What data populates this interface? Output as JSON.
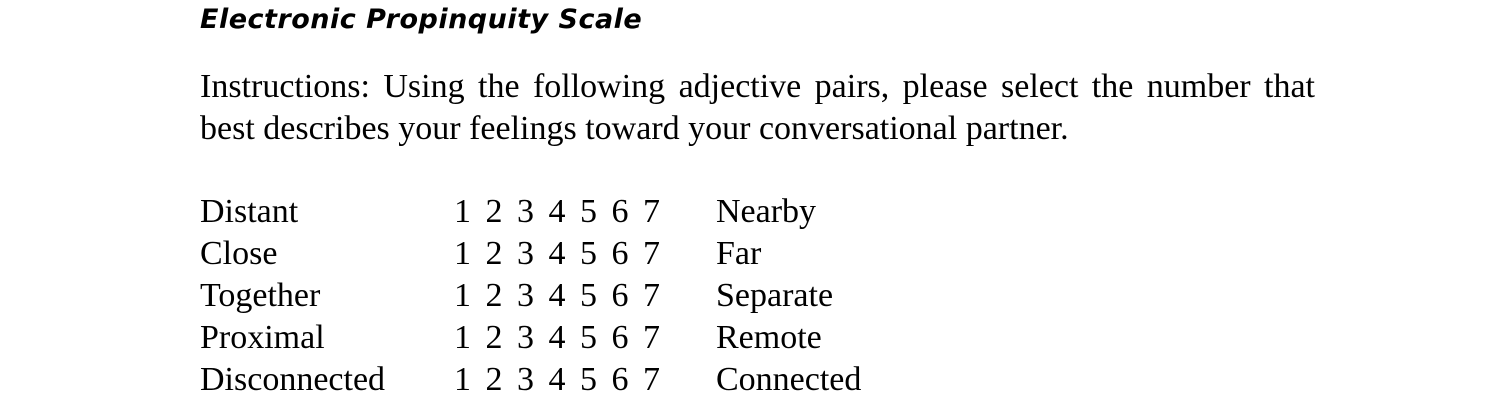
{
  "document": {
    "title": "Electronic Propinquity Scale",
    "instructions": "Instructions: Using the following adjective pairs, please select the number that best describes your feelings toward your conversational partner."
  },
  "scale": {
    "options": [
      "1",
      "2",
      "3",
      "4",
      "5",
      "6",
      "7"
    ],
    "items": [
      {
        "left": "Distant",
        "right": "Nearby"
      },
      {
        "left": "Close",
        "right": "Far"
      },
      {
        "left": "Together",
        "right": "Separate"
      },
      {
        "left": "Proximal",
        "right": "Remote"
      },
      {
        "left": "Disconnected",
        "right": "Connected"
      }
    ]
  }
}
